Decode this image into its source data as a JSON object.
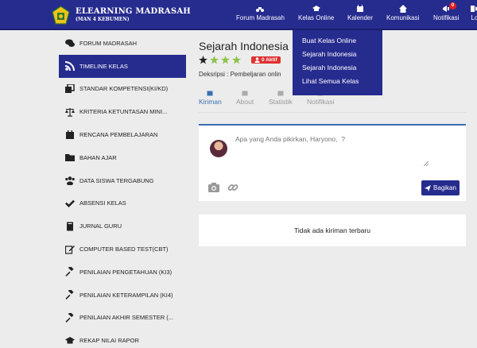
{
  "navbar": {
    "brand_title": "ELEARNING MADRASAH",
    "brand_subtitle": "(MAN 4 KEBUMEN)",
    "bg_color": "#262b8e",
    "items": [
      {
        "label": "Forum Madrasah",
        "icon": "motorcycle-icon"
      },
      {
        "label": "Kelas Online",
        "icon": "graduation-cap-icon"
      },
      {
        "label": "Kalender",
        "icon": "calendar-icon"
      },
      {
        "label": "Komunikasi",
        "icon": "home-icon"
      },
      {
        "label": "Notifikasi",
        "icon": "megaphone-icon",
        "badge": "0"
      },
      {
        "label": "Lo",
        "icon": "logout-icon"
      }
    ]
  },
  "dropdown": {
    "items": [
      "Buat Kelas Online",
      "Sejarah Indonesia",
      "Sejarah Indonesia",
      "Lihat Semua Kelas"
    ]
  },
  "sidebar": {
    "items": [
      {
        "label": "FORUM MADRASAH",
        "icon": "comments-icon"
      },
      {
        "label": "TIMELINE KELAS",
        "icon": "rss-icon",
        "active": true
      },
      {
        "label": "STANDAR KOMPETENSI(KI/KD)",
        "icon": "clone-icon"
      },
      {
        "label": "KRITERIA KETUNTASAN MINI...",
        "icon": "balance-scale-icon"
      },
      {
        "label": "RENCANA PEMBELAJARAN",
        "icon": "calendar-icon"
      },
      {
        "label": "BAHAN AJAR",
        "icon": "folder-icon"
      },
      {
        "label": "DATA SISWA TERGABUNG",
        "icon": "users-icon"
      },
      {
        "label": "ABSENSI KELAS",
        "icon": "check-icon"
      },
      {
        "label": "JURNAL GURU",
        "icon": "book-icon"
      },
      {
        "label": "COMPUTER BASED TEST(CBT)",
        "icon": "edit-icon"
      },
      {
        "label": "PENILAIAN PENGETAHUAN (KI3)",
        "icon": "gavel-icon"
      },
      {
        "label": "PENILAIAN KETERAMPILAN (KI4)",
        "icon": "gavel-icon"
      },
      {
        "label": "PENILAIAN AKHIR SEMESTER (...",
        "icon": "gavel-icon"
      },
      {
        "label": "REKAP NILAI RAPOR",
        "icon": "graduation-cap-icon"
      }
    ]
  },
  "course": {
    "title": "Sejarah Indonesia",
    "rating_stars": 3,
    "star_colors": [
      "#222222",
      "#8bc34a",
      "#8bc34a",
      "#8bc34a"
    ],
    "member_badge": "0 Aktif",
    "description": "Deksripsi : Pembeljaran onlin"
  },
  "tabs": [
    {
      "label": "Kiriman",
      "active": true
    },
    {
      "label": "About"
    },
    {
      "label": "Statistik"
    },
    {
      "label": "Notifikasi"
    }
  ],
  "composer": {
    "placeholder": "Apa yang Anda pikirkan, Haryono,  ?",
    "share_label": "Bagikan"
  },
  "feed": {
    "empty_message": "Tidak ada kiriman terbaru"
  },
  "colors": {
    "primary": "#262b8e",
    "accent": "#3a6fb0",
    "badge_red": "#e02020"
  }
}
